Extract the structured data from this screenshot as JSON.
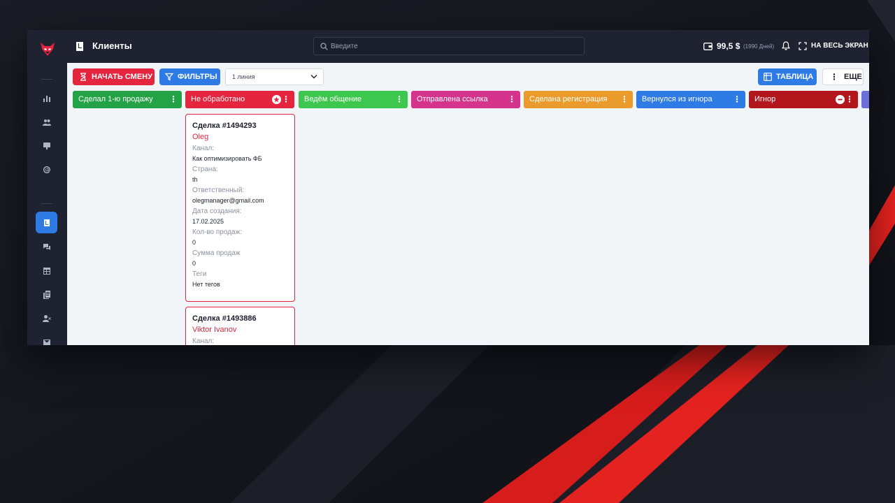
{
  "header": {
    "title": "Клиенты",
    "search_placeholder": "Введите",
    "balance": "99,5 $",
    "days": "(1990 Дней)",
    "fullscreen_label": "НА ВЕСЬ ЭКРАН"
  },
  "toolbar": {
    "start_shift": "НАЧАТЬ СМЕНУ",
    "filters": "ФИЛЬТРЫ",
    "line_select": "1 линия",
    "table": "ТАБЛИЦА",
    "more": "ЕЩЕ"
  },
  "columns": [
    {
      "label": "Сделал 1-ю продажу",
      "color": "#23a346"
    },
    {
      "label": "Не обработано",
      "color": "#e5253e"
    },
    {
      "label": "Ведём общение",
      "color": "#3ec74f"
    },
    {
      "label": "Отправлена ссылка",
      "color": "#d6338d"
    },
    {
      "label": "Сделана регистрация",
      "color": "#ea9b2c"
    },
    {
      "label": "Вернулся из игнора",
      "color": "#2f7be6"
    },
    {
      "label": "Игнор",
      "color": "#b3161c"
    }
  ],
  "cards": [
    {
      "deal": "Сделка #1494293",
      "name": "Oleg",
      "fields": [
        {
          "label": "Канал:",
          "value": "Как оптимизировать ФБ"
        },
        {
          "label": "Страна:",
          "value": "th"
        },
        {
          "label": "Ответственный:",
          "value": "olegmanager@gmail.com"
        },
        {
          "label": "Дата создания:",
          "value": "17.02.2025"
        },
        {
          "label": "Кол-во продаж:",
          "value": "0"
        },
        {
          "label": "Сумма продаж",
          "value": "0"
        },
        {
          "label": "Теги",
          "value": "Нет тегов"
        }
      ]
    },
    {
      "deal": "Сделка #1493886",
      "name": "Viktor Ivanov",
      "fields": [
        {
          "label": "Канал:",
          "value": ""
        }
      ]
    }
  ],
  "colors": {
    "accent_red": "#e5253e",
    "accent_blue": "#2f7be6",
    "sidebar_bg": "#1e2231",
    "content_bg": "#f1f5f8"
  }
}
